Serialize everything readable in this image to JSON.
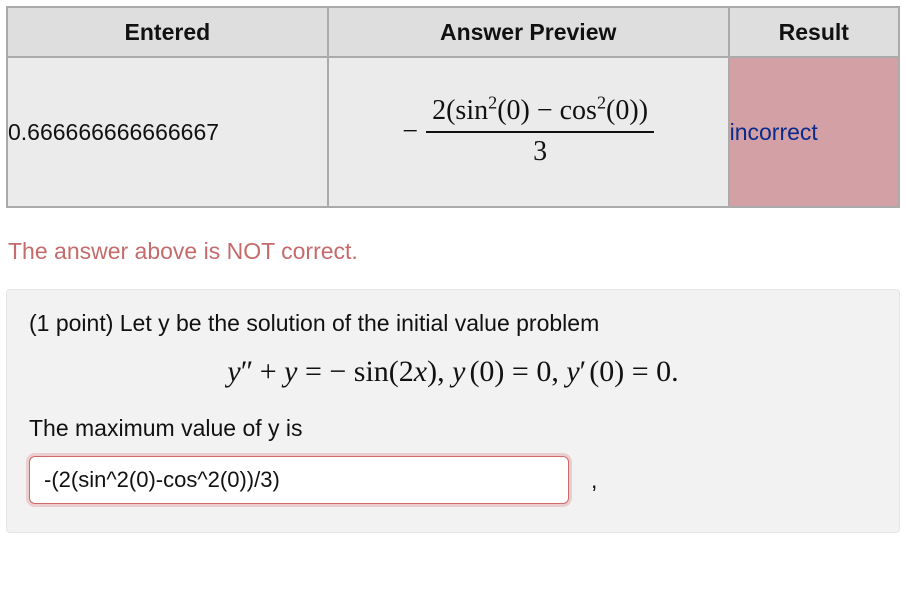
{
  "table": {
    "headers": {
      "entered": "Entered",
      "preview": "Answer Preview",
      "result": "Result"
    },
    "row": {
      "entered": "0.666666666666667",
      "result": "incorrect",
      "preview": {
        "leading_minus": "−",
        "numerator_html": "2(sin<sup>2</sup>(0) − cos<sup>2</sup>(0))",
        "denominator": "3"
      }
    }
  },
  "feedback": "The answer above is NOT correct.",
  "question": {
    "intro": "(1 point) Let y be the solution of the initial value problem",
    "equation_html": "y<span class='primes'>″</span> <span class='rm'>+</span> y <span class='rm'>=</span> <span class='rm'>−</span> <span class='rm'>sin(2</span>x<span class='rm'>),</span> y<span class='sp'></span><span class='rm'>(0)</span> <span class='rm'>= 0,</span> y<span class='primes'>′</span><span class='sp'></span><span class='rm'>(0)</span> <span class='rm'>= 0.</span>",
    "prompt": "The maximum value of y is",
    "input_value": "-(2(sin^2(0)-cos^2(0))/3)",
    "trailing": ","
  }
}
